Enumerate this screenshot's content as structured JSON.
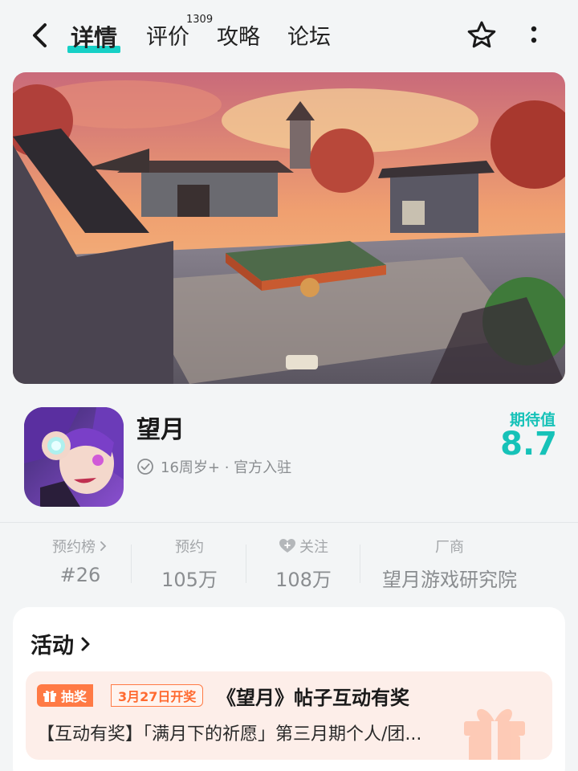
{
  "nav": {
    "tabs": [
      {
        "label": "详情"
      },
      {
        "label": "评价"
      },
      {
        "label": "攻略"
      },
      {
        "label": "论坛"
      }
    ],
    "review_count": "1309"
  },
  "game": {
    "name": "望月",
    "meta": "16周岁+ · 官方入驻",
    "expect_label": "期待值",
    "expect_score": "8.7"
  },
  "stats": [
    {
      "label": "预约榜",
      "value": "#26"
    },
    {
      "label": "预约",
      "value": "105万"
    },
    {
      "label": "关注",
      "value": "108万"
    },
    {
      "label": "厂商",
      "value": "望月游戏研究院"
    }
  ],
  "activity": {
    "title": "活动",
    "badge": "抽奖",
    "date": "3月27日开奖",
    "post_title": "《望月》帖子互动有奖",
    "post_desc": "【互动有奖】「满月下的祈愿」第三月期个人/团..."
  },
  "colors": {
    "accent": "#16c2b8",
    "underline": "#16d0c6",
    "promo_orange": "#ff7a45"
  }
}
